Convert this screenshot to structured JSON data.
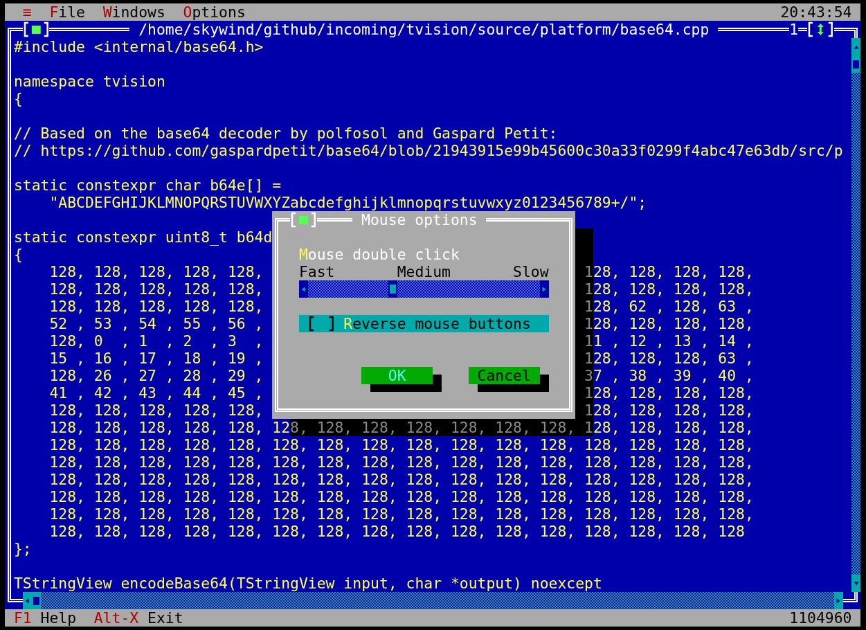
{
  "menu_bar": {
    "system_menu": "≡",
    "items": [
      {
        "hotkey": "F",
        "rest": "ile"
      },
      {
        "hotkey": "W",
        "rest": "indows"
      },
      {
        "hotkey": "O",
        "rest": "ptions"
      }
    ],
    "clock": "20:43:54"
  },
  "editor": {
    "title": "/home/skywind/github/incoming/tvision/source/platform/base64.cpp",
    "window_number": "1",
    "code_lines": [
      {
        "kind": "plain",
        "text": "#include <internal/base64.h>"
      },
      {
        "kind": "blank"
      },
      {
        "kind": "plain",
        "text": "namespace tvision"
      },
      {
        "kind": "plain",
        "text": "{"
      },
      {
        "kind": "blank"
      },
      {
        "kind": "plain",
        "text": "// Based on the base64 decoder by polfosol and Gaspard Petit:"
      },
      {
        "kind": "plain",
        "text": "// https://github.com/gaspardpetit/base64/blob/21943915e99b45600c30a33f0299f4abc47e63db/src/p"
      },
      {
        "kind": "blank"
      },
      {
        "kind": "plain",
        "text": "static constexpr char b64e[] ="
      },
      {
        "kind": "plain",
        "text": "    \"ABCDEFGHIJKLMNOPQRSTUVWXYZabcdefghijklmnopqrstuvwxyz0123456789+/\";"
      },
      {
        "kind": "blank"
      },
      {
        "kind": "overlay",
        "left": "static constexpr uint8_t b64d"
      },
      {
        "kind": "overlay",
        "left": "{"
      },
      {
        "kind": "overlay",
        "left": "    128, 128, 128, 128, 128,",
        "shadowed": "1",
        "right": "28, 128, 128, 128,"
      },
      {
        "kind": "overlay",
        "left": "    128, 128, 128, 128, 128,",
        "shadowed": "1",
        "right": "28, 128, 128, 128,"
      },
      {
        "kind": "overlay",
        "left": "    128, 128, 128, 128, 128,",
        "shadowed": "1",
        "right": "28, 62 , 128, 63 ,"
      },
      {
        "kind": "overlay",
        "left": "    52 , 53 , 54 , 55 , 56 ,",
        "shadowed": "1",
        "right": "28, 128, 128, 128,"
      },
      {
        "kind": "overlay",
        "left": "    128, 0  , 1  , 2  , 3  ,",
        "shadowed": "1",
        "right": "1 , 12 , 13 , 14 ,"
      },
      {
        "kind": "overlay",
        "left": "    15 , 16 , 17 , 18 , 19 ,",
        "shadowed": "1",
        "right": "28, 128, 128, 63 ,"
      },
      {
        "kind": "overlay",
        "left": "    128, 26 , 27 , 28 , 29 ,",
        "shadowed": "3",
        "right": "7 , 38 , 39 , 40 ,"
      },
      {
        "kind": "overlay",
        "left": "    41 , 42 , 43 , 44 , 45 ,",
        "shadowed": "1",
        "right": "28, 128, 128, 128,"
      },
      {
        "kind": "overlay",
        "left": "    128, 128, 128, 128, 128,",
        "shadowed": "1",
        "right": "28, 128, 128, 128,"
      },
      {
        "kind": "shadow_row",
        "left": "    128, 128, 128, 128, 128, 12",
        "shadowed": "8, 128, 128, 128, 128, 128, 128, 1",
        "right": "28, 128, 128, 128,"
      },
      {
        "kind": "plain",
        "text": "    128, 128, 128, 128, 128, 128, 128, 128, 128, 128, 128, 128, 128, 128, 128, 128,"
      },
      {
        "kind": "plain",
        "text": "    128, 128, 128, 128, 128, 128, 128, 128, 128, 128, 128, 128, 128, 128, 128, 128,"
      },
      {
        "kind": "plain",
        "text": "    128, 128, 128, 128, 128, 128, 128, 128, 128, 128, 128, 128, 128, 128, 128, 128,"
      },
      {
        "kind": "plain",
        "text": "    128, 128, 128, 128, 128, 128, 128, 128, 128, 128, 128, 128, 128, 128, 128, 128,"
      },
      {
        "kind": "plain",
        "text": "    128, 128, 128, 128, 128, 128, 128, 128, 128, 128, 128, 128, 128, 128, 128, 128,"
      },
      {
        "kind": "plain",
        "text": "    128, 128, 128, 128, 128, 128, 128, 128, 128, 128, 128, 128, 128, 128, 128, 128"
      },
      {
        "kind": "plain",
        "text": "};"
      },
      {
        "kind": "blank"
      },
      {
        "kind": "plain",
        "text": "TStringView encodeBase64(TStringView input, char *output) noexcept"
      }
    ]
  },
  "dialog": {
    "title": "Mouse options",
    "slider_label": {
      "hotkey": "M",
      "rest": "ouse double click"
    },
    "scale": [
      "Fast",
      "Medium",
      "Slow"
    ],
    "slider": {
      "level": 0.36
    },
    "checkbox": {
      "hotkey": "R",
      "rest": "everse mouse buttons",
      "checked": false,
      "focused": true
    },
    "buttons": [
      {
        "label": "OK",
        "default": true
      },
      {
        "label": "Cancel",
        "default": false
      }
    ]
  },
  "status_bar": {
    "items": [
      {
        "key": "F1",
        "label": "Help"
      },
      {
        "key": "Alt-X",
        "label": "Exit"
      }
    ],
    "memory": "1104960"
  }
}
